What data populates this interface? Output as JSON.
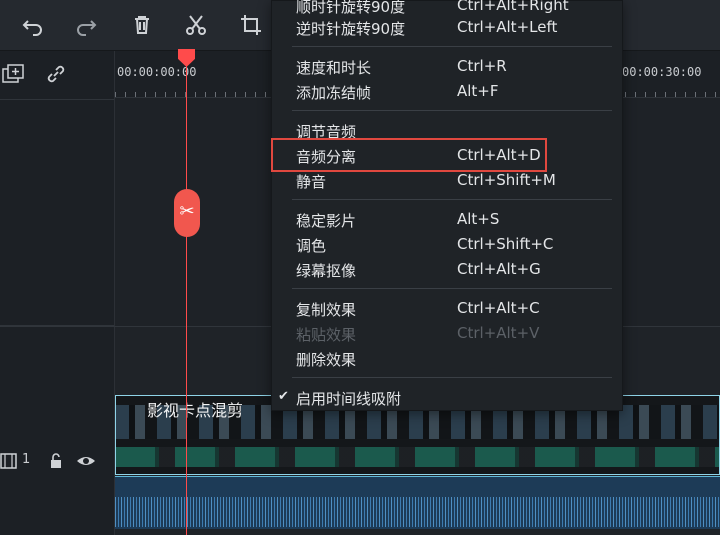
{
  "toolbar": {
    "icons": [
      "undo-icon",
      "redo-icon",
      "delete-icon",
      "cut-icon",
      "crop-icon"
    ]
  },
  "left_panel": {
    "track_number": "1",
    "icons": [
      "add-track-icon",
      "link-icon",
      "film-icon",
      "lock-icon",
      "eye-icon"
    ]
  },
  "ruler": {
    "start_time": "00:00:00:00",
    "end_time": "00:00:30:00"
  },
  "clip": {
    "title": "影视卡点混剪"
  },
  "menu": {
    "items": [
      {
        "label": "顺时针旋转90度",
        "shortcut": "Ctrl+Alt+Right",
        "disabled": false
      },
      {
        "label": "逆时针旋转90度",
        "shortcut": "Ctrl+Alt+Left",
        "disabled": false
      },
      {
        "label": "速度和时长",
        "shortcut": "Ctrl+R",
        "disabled": false
      },
      {
        "label": "添加冻结帧",
        "shortcut": "Alt+F",
        "disabled": false
      },
      {
        "label": "调节音频",
        "shortcut": "",
        "disabled": false
      },
      {
        "label": "音频分离",
        "shortcut": "Ctrl+Alt+D",
        "disabled": false
      },
      {
        "label": "静音",
        "shortcut": "Ctrl+Shift+M",
        "disabled": false
      },
      {
        "label": "稳定影片",
        "shortcut": "Alt+S",
        "disabled": false
      },
      {
        "label": "调色",
        "shortcut": "Ctrl+Shift+C",
        "disabled": false
      },
      {
        "label": "绿幕抠像",
        "shortcut": "Ctrl+Alt+G",
        "disabled": false
      },
      {
        "label": "复制效果",
        "shortcut": "Ctrl+Alt+C",
        "disabled": false
      },
      {
        "label": "粘贴效果",
        "shortcut": "Ctrl+Alt+V",
        "disabled": true
      },
      {
        "label": "删除效果",
        "shortcut": "",
        "disabled": false
      },
      {
        "label": "启用时间线吸附",
        "shortcut": "",
        "disabled": false,
        "checked": true
      }
    ]
  },
  "colors": {
    "accent": "#ff4b4b",
    "highlight_border": "#e0483f",
    "menu_bg": "#1f2327"
  }
}
